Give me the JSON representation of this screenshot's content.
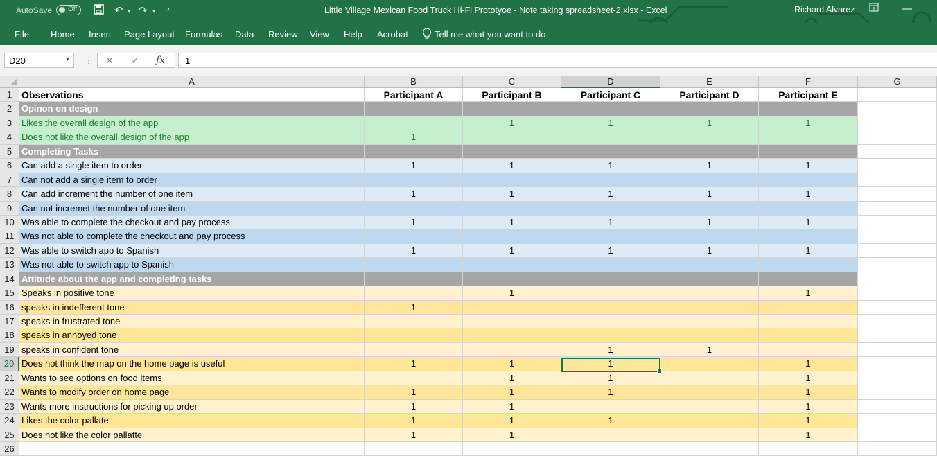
{
  "titlebar": {
    "autosave_label": "AutoSave",
    "autosave_state": "Off",
    "doc_title": "Little Village Mexican Food Truck Hi-Fi Prototyoe - Note taking spreadsheet-2.xlsx  -  Excel",
    "user": "Richard Alvarez"
  },
  "menu": [
    "File",
    "Home",
    "Insert",
    "Page Layout",
    "Formulas",
    "Data",
    "Review",
    "View",
    "Help",
    "Acrobat",
    "Tell me what you want to do"
  ],
  "formula": {
    "namebox": "D20",
    "value": "1"
  },
  "columns": [
    "A",
    "B",
    "C",
    "D",
    "E",
    "F",
    "G"
  ],
  "selected_column": "D",
  "selected_row": "20",
  "header_row": [
    "Observations",
    "Participant A",
    "Participant B",
    "Participant C",
    "Participant D",
    "Participant E"
  ],
  "rows": [
    {
      "n": "1",
      "style": "hdr",
      "cells": [
        "Observations",
        "Participant A",
        "Participant B",
        "Participant C",
        "Participant D",
        "Participant E"
      ]
    },
    {
      "n": "2",
      "style": "sec",
      "cells": [
        "Opinon on design",
        "",
        "",
        "",
        "",
        ""
      ]
    },
    {
      "n": "3",
      "style": "green",
      "cells": [
        "Likes the overall design of the app",
        "",
        "1",
        "1",
        "1",
        "1"
      ]
    },
    {
      "n": "4",
      "style": "green",
      "cells": [
        "Does not like the overall design of the app",
        "1",
        "",
        "",
        "",
        ""
      ]
    },
    {
      "n": "5",
      "style": "sec",
      "cells": [
        "Completing Tasks",
        "",
        "",
        "",
        "",
        ""
      ]
    },
    {
      "n": "6",
      "style": "blue2",
      "cells": [
        "Can add a single item to order",
        "1",
        "1",
        "1",
        "1",
        "1"
      ]
    },
    {
      "n": "7",
      "style": "blue",
      "cells": [
        "Can not add a single item to order",
        "",
        "",
        "",
        "",
        ""
      ]
    },
    {
      "n": "8",
      "style": "blue2",
      "cells": [
        "Can add increment the number of one item",
        "1",
        "1",
        "1",
        "1",
        "1"
      ]
    },
    {
      "n": "9",
      "style": "blue",
      "cells": [
        "Can not incremet the number of one item",
        "",
        "",
        "",
        "",
        ""
      ]
    },
    {
      "n": "10",
      "style": "blue2",
      "cells": [
        "Was able to complete the checkout and pay process",
        "1",
        "1",
        "1",
        "1",
        "1"
      ]
    },
    {
      "n": "11",
      "style": "blue",
      "cells": [
        "Was not able to complete the checkout and pay process",
        "",
        "",
        "",
        "",
        ""
      ]
    },
    {
      "n": "12",
      "style": "blue2",
      "cells": [
        "Was able to switch app to Spanish",
        "1",
        "1",
        "1",
        "1",
        "1"
      ]
    },
    {
      "n": "13",
      "style": "blue",
      "cells": [
        "Was not able to switch app to Spanish",
        "",
        "",
        "",
        "",
        ""
      ]
    },
    {
      "n": "14",
      "style": "sec",
      "cells": [
        "Attitude about the app and completing tasks",
        "",
        "",
        "",
        "",
        ""
      ]
    },
    {
      "n": "15",
      "style": "yel",
      "cells": [
        "Speaks in positive tone",
        "",
        "1",
        "",
        "",
        "1"
      ]
    },
    {
      "n": "16",
      "style": "yel2",
      "cells": [
        "speaks in indefferent tone",
        "1",
        "",
        "",
        "",
        ""
      ]
    },
    {
      "n": "17",
      "style": "yel",
      "cells": [
        "speaks in frustrated tone",
        "",
        "",
        "",
        "",
        ""
      ]
    },
    {
      "n": "18",
      "style": "yel2",
      "cells": [
        "speaks in annoyed tone",
        "",
        "",
        "",
        "",
        ""
      ]
    },
    {
      "n": "19",
      "style": "yel",
      "cells": [
        "speaks in confident tone",
        "",
        "",
        "1",
        "1",
        ""
      ]
    },
    {
      "n": "20",
      "style": "yel2",
      "cells": [
        "Does not think the map on the home page is useful",
        "1",
        "1",
        "1",
        "",
        "1"
      ]
    },
    {
      "n": "21",
      "style": "yel",
      "cells": [
        "Wants to see options on food items",
        "",
        "1",
        "1",
        "",
        "1"
      ]
    },
    {
      "n": "22",
      "style": "yel2",
      "cells": [
        "Wants to modify order on home page",
        "1",
        "1",
        "1",
        "",
        "1"
      ]
    },
    {
      "n": "23",
      "style": "yel",
      "cells": [
        "Wants more instructions for picking up order",
        "1",
        "1",
        "",
        "",
        "1"
      ]
    },
    {
      "n": "24",
      "style": "yel2",
      "cells": [
        "Likes the color pallate",
        "1",
        "1",
        "1",
        "",
        "1"
      ]
    },
    {
      "n": "25",
      "style": "yel",
      "cells": [
        "Does not like the color pallatte",
        "1",
        "1",
        "",
        "",
        "1"
      ]
    },
    {
      "n": "26",
      "style": "blank",
      "cells": [
        "",
        "",
        "",
        "",
        "",
        ""
      ]
    }
  ],
  "colors": {
    "excel_green": "#217346",
    "section_gray": "#a6a6a6",
    "green_fill": "#c6efce",
    "blue_fill": "#bdd7ee",
    "yellow_fill": "#ffe699"
  }
}
